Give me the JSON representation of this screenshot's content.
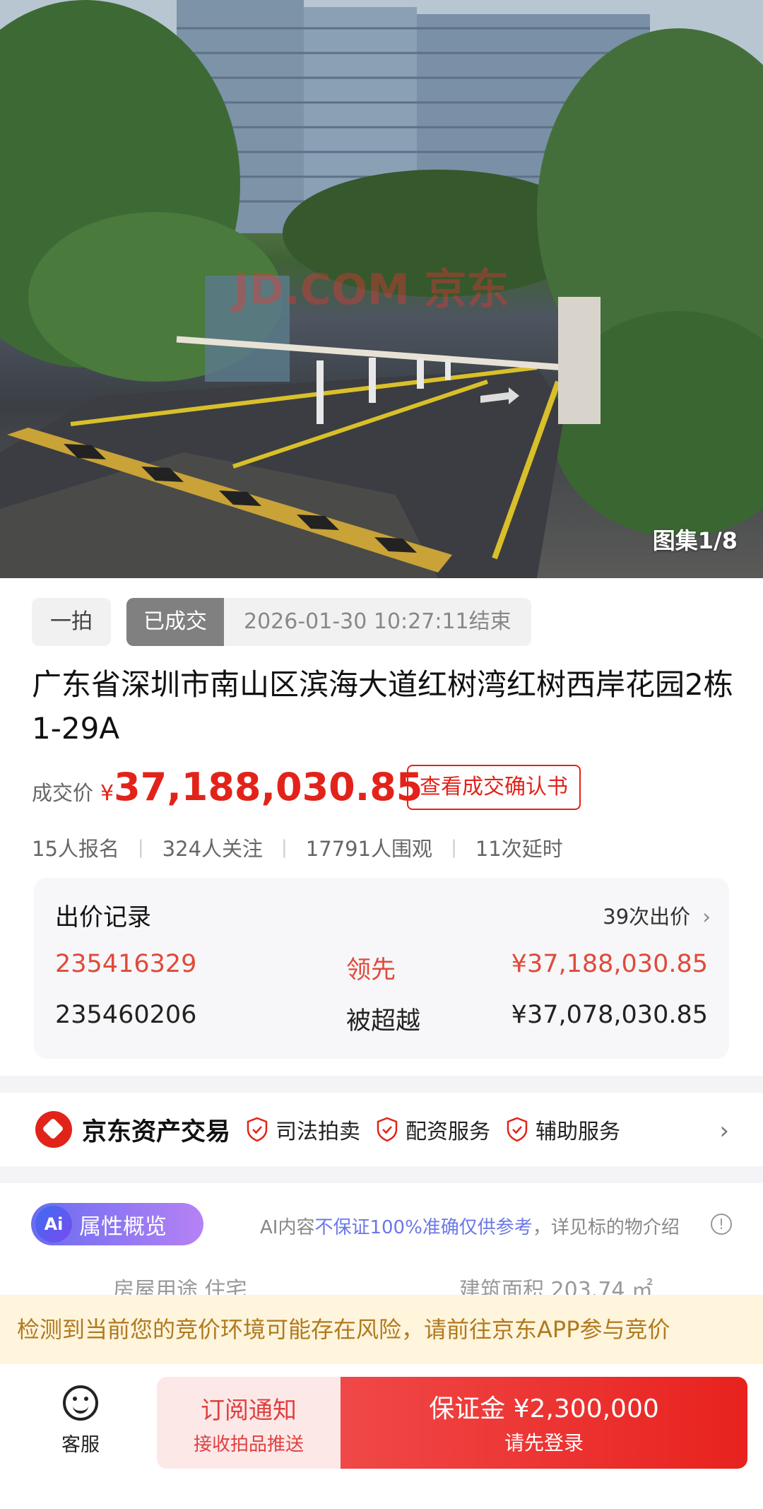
{
  "gallery": {
    "counter": "图集1/8",
    "watermark": "JD.COM 京东"
  },
  "tags": {
    "round": "一拍",
    "status": "已成交",
    "end_time": "2026-01-30 10:27:11结束"
  },
  "title": "广东省深圳市南山区滨海大道红树湾红树西岸花园2栋1-29A",
  "price": {
    "label": "成交价",
    "currency": "¥",
    "value": "37,188,030.85",
    "confirm_label": "查看成交确认书"
  },
  "stats": [
    "15人报名",
    "324人关注",
    "17791人围观",
    "11次延时"
  ],
  "bids": {
    "title": "出价记录",
    "count": "39次出价",
    "rows": [
      {
        "id": "235416329",
        "state": "领先",
        "amount": "¥37,188,030.85"
      },
      {
        "id": "235460206",
        "state": "被超越",
        "amount": "¥37,078,030.85"
      }
    ]
  },
  "service": {
    "brand": "京东资产交易",
    "items": [
      "司法拍卖",
      "配资服务",
      "辅助服务"
    ]
  },
  "attributes": {
    "pill_badge": "Ai",
    "pill_label": "属性概览",
    "disclaimer_prefix": "AI内容",
    "disclaimer_highlight": "不保证100%准确仅供参考",
    "disclaimer_suffix": "，详见标的物介绍",
    "info_glyph": "!",
    "peek_left": "房屋用途 住宅",
    "peek_right": "建筑面积 203.74 ㎡"
  },
  "risk_banner": "检测到当前您的竞价环境可能存在风险，请前往京东APP参与竞价",
  "bottom": {
    "service_label": "客服",
    "subscribe_main": "订阅通知",
    "subscribe_sub": "接收拍品推送",
    "deposit_main": "保证金 ¥2,300,000",
    "deposit_sub": "请先登录"
  },
  "colors": {
    "accent_red": "#e2231a",
    "lead_red": "#e04a3a",
    "banner_bg": "#fff4dc",
    "banner_text": "#b07a1e"
  }
}
